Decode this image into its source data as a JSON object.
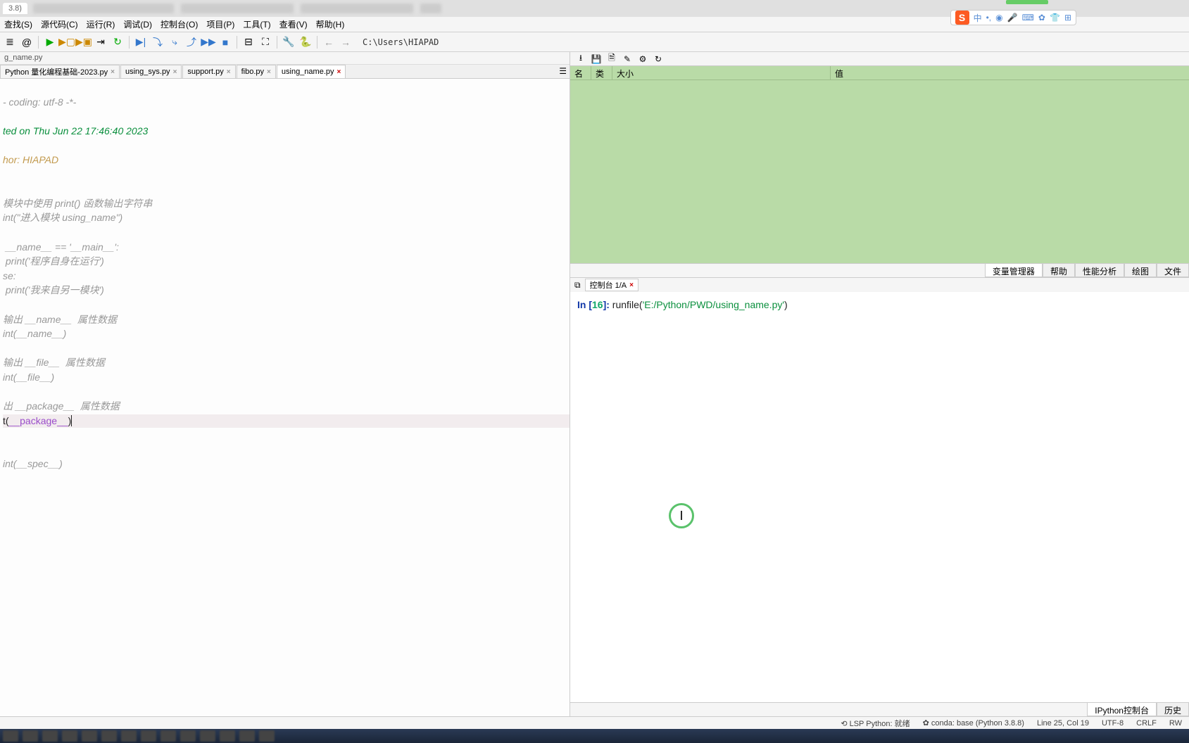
{
  "browser": {
    "version_tab": "3.8)"
  },
  "ime": {
    "logo": "S",
    "items": [
      "中",
      "•,",
      "◉",
      "🎤",
      "⌨",
      "✿",
      "👕",
      "⊞"
    ]
  },
  "menubar": [
    "查找(S)",
    "源代码(C)",
    "运行(R)",
    "调试(D)",
    "控制台(O)",
    "项目(P)",
    "工具(T)",
    "查看(V)",
    "帮助(H)"
  ],
  "toolbar": {
    "path": "C:\\Users\\HIAPAD"
  },
  "breadcrumb": "g_name.py",
  "editor_tabs": [
    {
      "label": "Python 量化编程基础-2023.py",
      "close": "grey",
      "active": false
    },
    {
      "label": "using_sys.py",
      "close": "grey",
      "active": false
    },
    {
      "label": "support.py",
      "close": "grey",
      "active": false
    },
    {
      "label": "fibo.py",
      "close": "grey",
      "active": false
    },
    {
      "label": "using_name.py",
      "close": "red",
      "active": true
    }
  ],
  "code": {
    "l1": "- coding: utf-8 -*-",
    "l2": "",
    "l3": "ted on Thu Jun 22 17:46:40 2023",
    "l4": "",
    "l5": "hor: HIAPAD",
    "l6": "",
    "l7": "",
    "l8": "模块中使用 print() 函数输出字符串",
    "l9": "int(\"进入模块 using_name\")",
    "l10": "",
    "l11": " __name__ == '__main__':",
    "l12": " print('程序自身在运行')",
    "l13": "se:",
    "l14": " print('我来自另一模块')",
    "l15": "",
    "l16": "输出 __name__  属性数据",
    "l17": "int(__name__)",
    "l18": "",
    "l19": "输出 __file__  属性数据",
    "l20": "int(__file__)",
    "l21": "",
    "l22": "出 __package__  属性数据",
    "l23a": "t(",
    "l23b": "__package__",
    "l23c": ")",
    "l24": "",
    "l25": "",
    "l26": "int(__spec__)"
  },
  "var_header": {
    "c1": "名称",
    "c2": "类型",
    "c3": "大小",
    "c4": "值"
  },
  "var_tabs": [
    "变量管理器",
    "帮助",
    "性能分析",
    "绘图",
    "文件"
  ],
  "console_tab": "控制台 1/A",
  "console": {
    "in_label": "In [",
    "num": "16",
    "close": "]: ",
    "cmd": "runfile(",
    "arg": "'E:/Python/PWD/using_name.py'",
    "end": ")"
  },
  "console_tabs_bottom": [
    "IPython控制台",
    "历史"
  ],
  "status": {
    "lsp": "⟲ LSP Python: 就绪",
    "conda": "✿ conda: base (Python 3.8.8)",
    "pos": "Line 25, Col 19",
    "enc": "UTF-8",
    "eol": "CRLF",
    "mode": "RW"
  },
  "cursor_glyph": "I"
}
